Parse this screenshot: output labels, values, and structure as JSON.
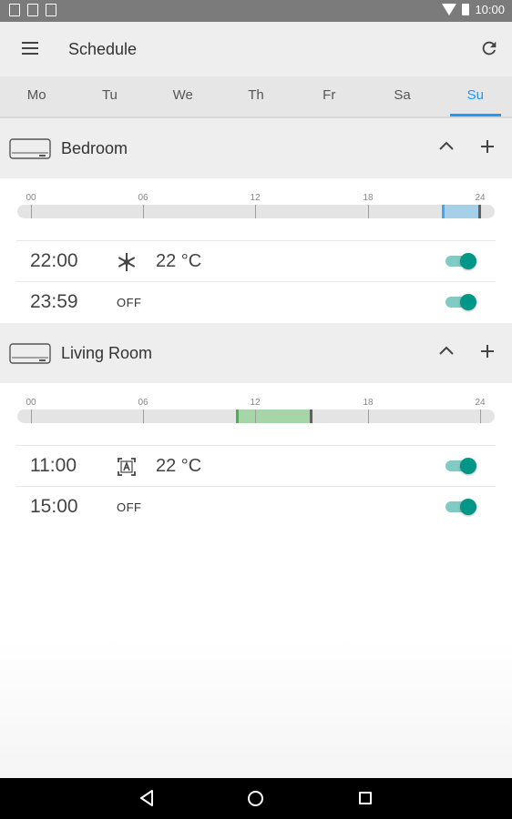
{
  "status_bar": {
    "time": "10:00",
    "icons": [
      "image-notification-icon",
      "download-notification-icon",
      "task-notification-icon",
      "wifi-icon",
      "battery-icon"
    ]
  },
  "app_bar": {
    "title": "Schedule",
    "menu_icon": "menu-icon",
    "refresh_icon": "refresh-icon"
  },
  "day_tabs": {
    "items": [
      {
        "label": "Mo"
      },
      {
        "label": "Tu"
      },
      {
        "label": "We"
      },
      {
        "label": "Th"
      },
      {
        "label": "Fr"
      },
      {
        "label": "Sa"
      },
      {
        "label": "Su"
      }
    ],
    "selected": "Su"
  },
  "timeline_ticks": [
    "00",
    "06",
    "12",
    "18",
    "24"
  ],
  "colors": {
    "accent": "#2196f3",
    "toggle_on": "#009688",
    "cool_segment": "#a6cfe8",
    "auto_segment": "#a5d6a7"
  },
  "rooms": [
    {
      "name": "Bedroom",
      "segment": {
        "start_hour": 22.0,
        "end_hour": 23.98,
        "mode": "cool"
      },
      "entries": [
        {
          "time": "22:00",
          "mode_icon": "snowflake-icon",
          "temperature": "22 °C",
          "enabled": true
        },
        {
          "time": "23:59",
          "off_label": "OFF",
          "enabled": true
        }
      ]
    },
    {
      "name": "Living Room",
      "segment": {
        "start_hour": 11.0,
        "end_hour": 15.0,
        "mode": "auto"
      },
      "entries": [
        {
          "time": "11:00",
          "mode_icon": "auto-mode-icon",
          "temperature": "22 °C",
          "enabled": true
        },
        {
          "time": "15:00",
          "off_label": "OFF",
          "enabled": true
        }
      ]
    }
  ]
}
